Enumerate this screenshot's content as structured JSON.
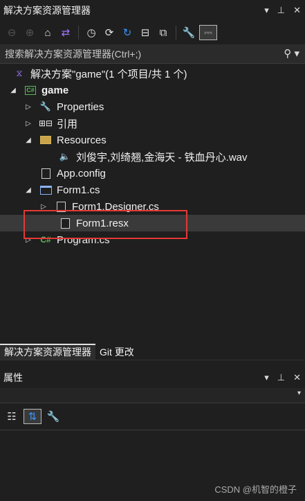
{
  "explorer": {
    "title": "解决方案资源管理器",
    "title_buttons": [
      "▾",
      "📌",
      "✕"
    ],
    "search_placeholder": "搜索解决方案资源管理器(Ctrl+;)"
  },
  "toolbar_icons": [
    "back-icon",
    "forward-icon",
    "home-icon",
    "switch-views-icon",
    "history-icon",
    "sync-icon",
    "refresh-icon",
    "collapse-all-icon",
    "show-all-files-icon",
    "properties-icon",
    "preview-icon"
  ],
  "tree": {
    "solution": "解决方案\"game\"(1 个项目/共 1 个)",
    "project": "game",
    "properties": "Properties",
    "references": "引用",
    "resources": "Resources",
    "wav_file": "刘俊宇,刘绮翘,金海天 - 铁血丹心.wav",
    "app_config": "App.config",
    "form1_cs": "Form1.cs",
    "form1_designer": "Form1.Designer.cs",
    "form1_resx": "Form1.resx",
    "program_cs": "Program.cs"
  },
  "tabs": [
    "解决方案资源管理器",
    "Git 更改"
  ],
  "properties_panel": {
    "title": "属性"
  },
  "watermark": "CSDN @机智的橙子",
  "colors": {
    "highlight": "#e53935",
    "accent": "#3794ff",
    "selection": "#3a3a3a"
  }
}
